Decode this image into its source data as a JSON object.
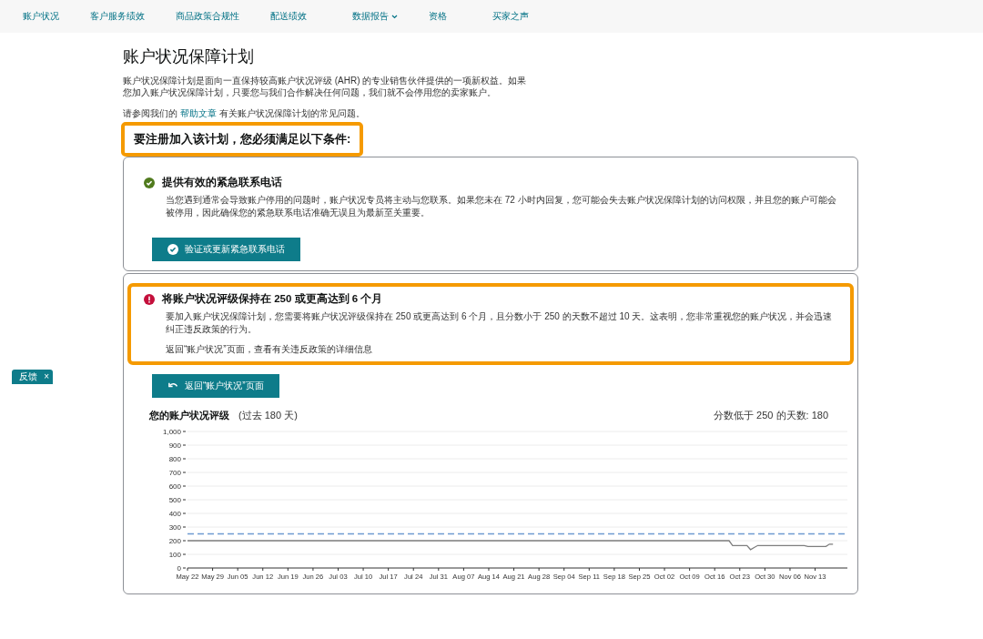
{
  "nav": {
    "items": [
      {
        "label": "账户状况",
        "has_menu": false
      },
      {
        "label": "客户服务绩效",
        "has_menu": false
      },
      {
        "label": "商品政策合规性",
        "has_menu": false
      },
      {
        "label": "配送绩效",
        "has_menu": false
      },
      {
        "label": "数据报告",
        "has_menu": true
      },
      {
        "label": "资格",
        "has_menu": false
      },
      {
        "label": "买家之声",
        "has_menu": false
      }
    ]
  },
  "page_title": "账户状况保障计划",
  "intro": "账户状况保障计划是面向一直保持较高账户状况评级 (AHR) 的专业销售伙伴提供的一项新权益。如果您加入账户状况保障计划，只要您与我们合作解决任何问题，我们就不会停用您的卖家账户。",
  "help": {
    "before": "请参阅我们的",
    "link": "帮助文章",
    "after": "有关账户状况保障计划的常见问题。"
  },
  "requirements_heading": {
    "text": "要注册加入该计划，您必须满足以下条件:",
    "highlighted": true
  },
  "requirements": [
    {
      "met": true,
      "highlighted": false,
      "title": "提供有效的紧急联系电话",
      "text": "当您遇到通常会导致账户停用的问题时，账户状况专员将主动与您联系。如果您未在 72 小时内回复，您可能会失去账户状况保障计划的访问权限，并且您的账户可能会被停用，因此确保您的紧急联系电话准确无误且为最新至关重要。",
      "button": {
        "kind": "verify",
        "label": "验证或更新紧急联系电话"
      }
    },
    {
      "met": false,
      "highlighted": true,
      "title": "将账户状况评级保持在 250 或更高达到 6 个月",
      "text": "要加入账户状况保障计划，您需要将账户状况评级保持在 250 或更高达到 6 个月，且分数小于 250 的天数不超过 10 天。这表明，您非常重视您的账户状况，并会迅速纠正违反政策的行为。",
      "note": "返回“账户状况”页面，查看有关违反政策的详细信息",
      "button": {
        "kind": "return",
        "label": "返回“账户状况”页面"
      },
      "chart": {
        "title": "您的账户状况评级",
        "subtitle": "(过去 180 天)",
        "summary": "分数低于 250 的天数: 180",
        "chart_data": {
          "type": "line",
          "categories": [
            "May 22",
            null,
            null,
            null,
            null,
            null,
            null,
            "May 29",
            null,
            null,
            null,
            null,
            null,
            null,
            "Jun 05",
            null,
            null,
            null,
            null,
            null,
            null,
            "Jun 12",
            null,
            null,
            null,
            null,
            null,
            null,
            "Jun 19",
            null,
            null,
            null,
            null,
            null,
            null,
            "Jun 26",
            null,
            null,
            null,
            null,
            null,
            null,
            "Jul 03",
            null,
            null,
            null,
            null,
            null,
            null,
            "Jul 10",
            null,
            null,
            null,
            null,
            null,
            null,
            "Jul 17",
            null,
            null,
            null,
            null,
            null,
            null,
            "Jul 24",
            null,
            null,
            null,
            null,
            null,
            null,
            "Jul 31",
            null,
            null,
            null,
            null,
            null,
            null,
            "Aug 07",
            null,
            null,
            null,
            null,
            null,
            null,
            "Aug 14",
            null,
            null,
            null,
            null,
            null,
            null,
            "Aug 21",
            null,
            null,
            null,
            null,
            null,
            null,
            "Aug 28",
            null,
            null,
            null,
            null,
            null,
            null,
            "Sep 04",
            null,
            null,
            null,
            null,
            null,
            null,
            "Sep 11",
            null,
            null,
            null,
            null,
            null,
            null,
            "Sep 18",
            null,
            null,
            null,
            null,
            null,
            null,
            "Sep 25",
            null,
            null,
            null,
            null,
            null,
            null,
            "Oct 02",
            null,
            null,
            null,
            null,
            null,
            null,
            "Oct 09",
            null,
            null,
            null,
            null,
            null,
            null,
            "Oct 16",
            null,
            null,
            null,
            null,
            null,
            null,
            "Oct 23",
            null,
            null,
            null,
            null,
            null,
            null,
            "Oct 30",
            null,
            null,
            null,
            null,
            null,
            null,
            "Nov 06",
            null,
            null,
            null,
            null,
            null,
            null,
            "Nov 13",
            null,
            null,
            null,
            null,
            null,
            null,
            null,
            null,
            null
          ],
          "series": [
            {
              "color": "#7d7d7d",
              "line_style": "solid",
              "values": [
                200,
                200,
                200,
                200,
                200,
                200,
                200,
                200,
                200,
                200,
                200,
                200,
                200,
                200,
                200,
                200,
                200,
                200,
                200,
                200,
                200,
                200,
                200,
                200,
                200,
                200,
                200,
                200,
                200,
                200,
                200,
                200,
                200,
                200,
                200,
                200,
                200,
                200,
                200,
                200,
                200,
                200,
                200,
                200,
                200,
                200,
                200,
                200,
                200,
                200,
                200,
                200,
                200,
                200,
                200,
                200,
                200,
                200,
                200,
                200,
                200,
                200,
                200,
                200,
                200,
                200,
                200,
                200,
                200,
                200,
                200,
                200,
                200,
                200,
                200,
                200,
                200,
                200,
                200,
                200,
                200,
                200,
                200,
                200,
                200,
                200,
                200,
                200,
                200,
                200,
                200,
                200,
                200,
                200,
                200,
                200,
                200,
                200,
                200,
                200,
                200,
                200,
                200,
                200,
                200,
                200,
                200,
                200,
                200,
                200,
                200,
                200,
                200,
                200,
                200,
                200,
                200,
                200,
                200,
                200,
                200,
                200,
                200,
                200,
                200,
                200,
                200,
                200,
                200,
                200,
                200,
                200,
                200,
                200,
                200,
                200,
                200,
                200,
                200,
                200,
                200,
                200,
                200,
                200,
                200,
                200,
                200,
                200,
                200,
                200,
                200,
                200,
                165,
                165,
                165,
                165,
                165,
                135,
                150,
                165,
                165,
                165,
                165,
                165,
                165,
                165,
                165,
                165,
                165,
                165,
                165,
                165,
                165,
                158,
                158,
                158,
                158,
                158,
                158,
                175,
                175,
                null,
                null,
                null,
                null
              ]
            },
            {
              "color": "#6f9bd1",
              "line_style": "dashed",
              "values": [
                250,
                250,
                250,
                250,
                250,
                250,
                250,
                250,
                250,
                250,
                250,
                250,
                250,
                250,
                250,
                250,
                250,
                250,
                250,
                250,
                250,
                250,
                250,
                250,
                250,
                250,
                250,
                250,
                250,
                250,
                250,
                250,
                250,
                250,
                250,
                250,
                250,
                250,
                250,
                250,
                250,
                250,
                250,
                250,
                250,
                250,
                250,
                250,
                250,
                250,
                250,
                250,
                250,
                250,
                250,
                250,
                250,
                250,
                250,
                250,
                250,
                250,
                250,
                250,
                250,
                250,
                250,
                250,
                250,
                250,
                250,
                250,
                250,
                250,
                250,
                250,
                250,
                250,
                250,
                250,
                250,
                250,
                250,
                250,
                250,
                250,
                250,
                250,
                250,
                250,
                250,
                250,
                250,
                250,
                250,
                250,
                250,
                250,
                250,
                250,
                250,
                250,
                250,
                250,
                250,
                250,
                250,
                250,
                250,
                250,
                250,
                250,
                250,
                250,
                250,
                250,
                250,
                250,
                250,
                250,
                250,
                250,
                250,
                250,
                250,
                250,
                250,
                250,
                250,
                250,
                250,
                250,
                250,
                250,
                250,
                250,
                250,
                250,
                250,
                250,
                250,
                250,
                250,
                250,
                250,
                250,
                250,
                250,
                250,
                250,
                250,
                250,
                250,
                250,
                250,
                250,
                250,
                250,
                250,
                250,
                250,
                250,
                250,
                250,
                250,
                250,
                250,
                250,
                250,
                250,
                250,
                250,
                250,
                250,
                250,
                250,
                250,
                250,
                250,
                250,
                250,
                250,
                250,
                250,
                250
              ]
            }
          ],
          "grid": true,
          "ylim": [
            0,
            1000
          ],
          "yticks": [
            0,
            100,
            200,
            300,
            400,
            500,
            600,
            700,
            800,
            900,
            {
              "value": 1000,
              "label": "1,000"
            }
          ]
        }
      }
    }
  ],
  "feedback": {
    "label": "反馈",
    "close": "×"
  }
}
